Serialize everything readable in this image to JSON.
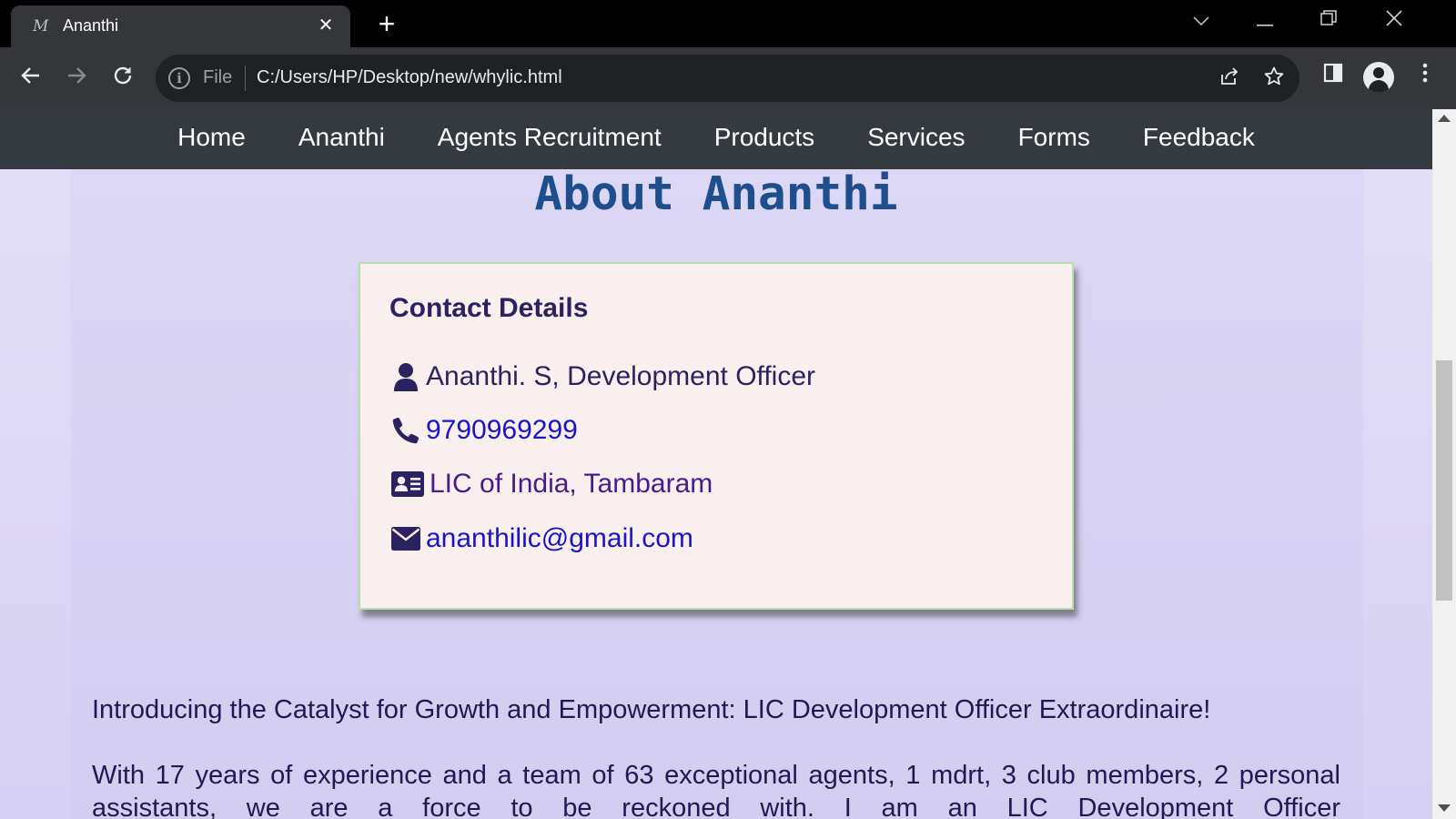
{
  "browser": {
    "tab_title": "Ananthi",
    "tab_favicon": "M",
    "new_tab_label": "+",
    "url_scheme": "File",
    "url": "C:/Users/HP/Desktop/new/whylic.html",
    "icons": [
      "back-icon",
      "forward-icon",
      "reload-icon",
      "info-icon",
      "share-icon",
      "star-icon",
      "side-panel-icon",
      "profile-icon",
      "menu-icon",
      "minimize-icon",
      "restore-icon",
      "close-icon",
      "tab-search-icon"
    ]
  },
  "site_nav": {
    "items": [
      "Home",
      "Ananthi",
      "Agents Recruitment",
      "Products",
      "Services",
      "Forms",
      "Feedback"
    ]
  },
  "page": {
    "heading": "About Ananthi",
    "contact": {
      "title": "Contact Details",
      "name": "Ananthi. S, Development Officer",
      "phone": "9790969299",
      "office": "LIC of India, Tambaram",
      "email": "ananthilic@gmail.com"
    },
    "intro": "Introducing the Catalyst for Growth and Empowerment: LIC Development Officer Extraordinaire!",
    "paragraph": "With 17 years of experience and a team of 63 exceptional agents, 1 mdrt, 3 club members, 2 personal assistants, we are a force to be reckoned with. I am an LIC Development Officer"
  },
  "colors": {
    "nav_bg": "#343a40",
    "heading": "#1f4e8c",
    "card_bg": "#f9efef",
    "card_border": "#b7ddb0",
    "link": "#1a14c8",
    "text": "#2b2262"
  }
}
